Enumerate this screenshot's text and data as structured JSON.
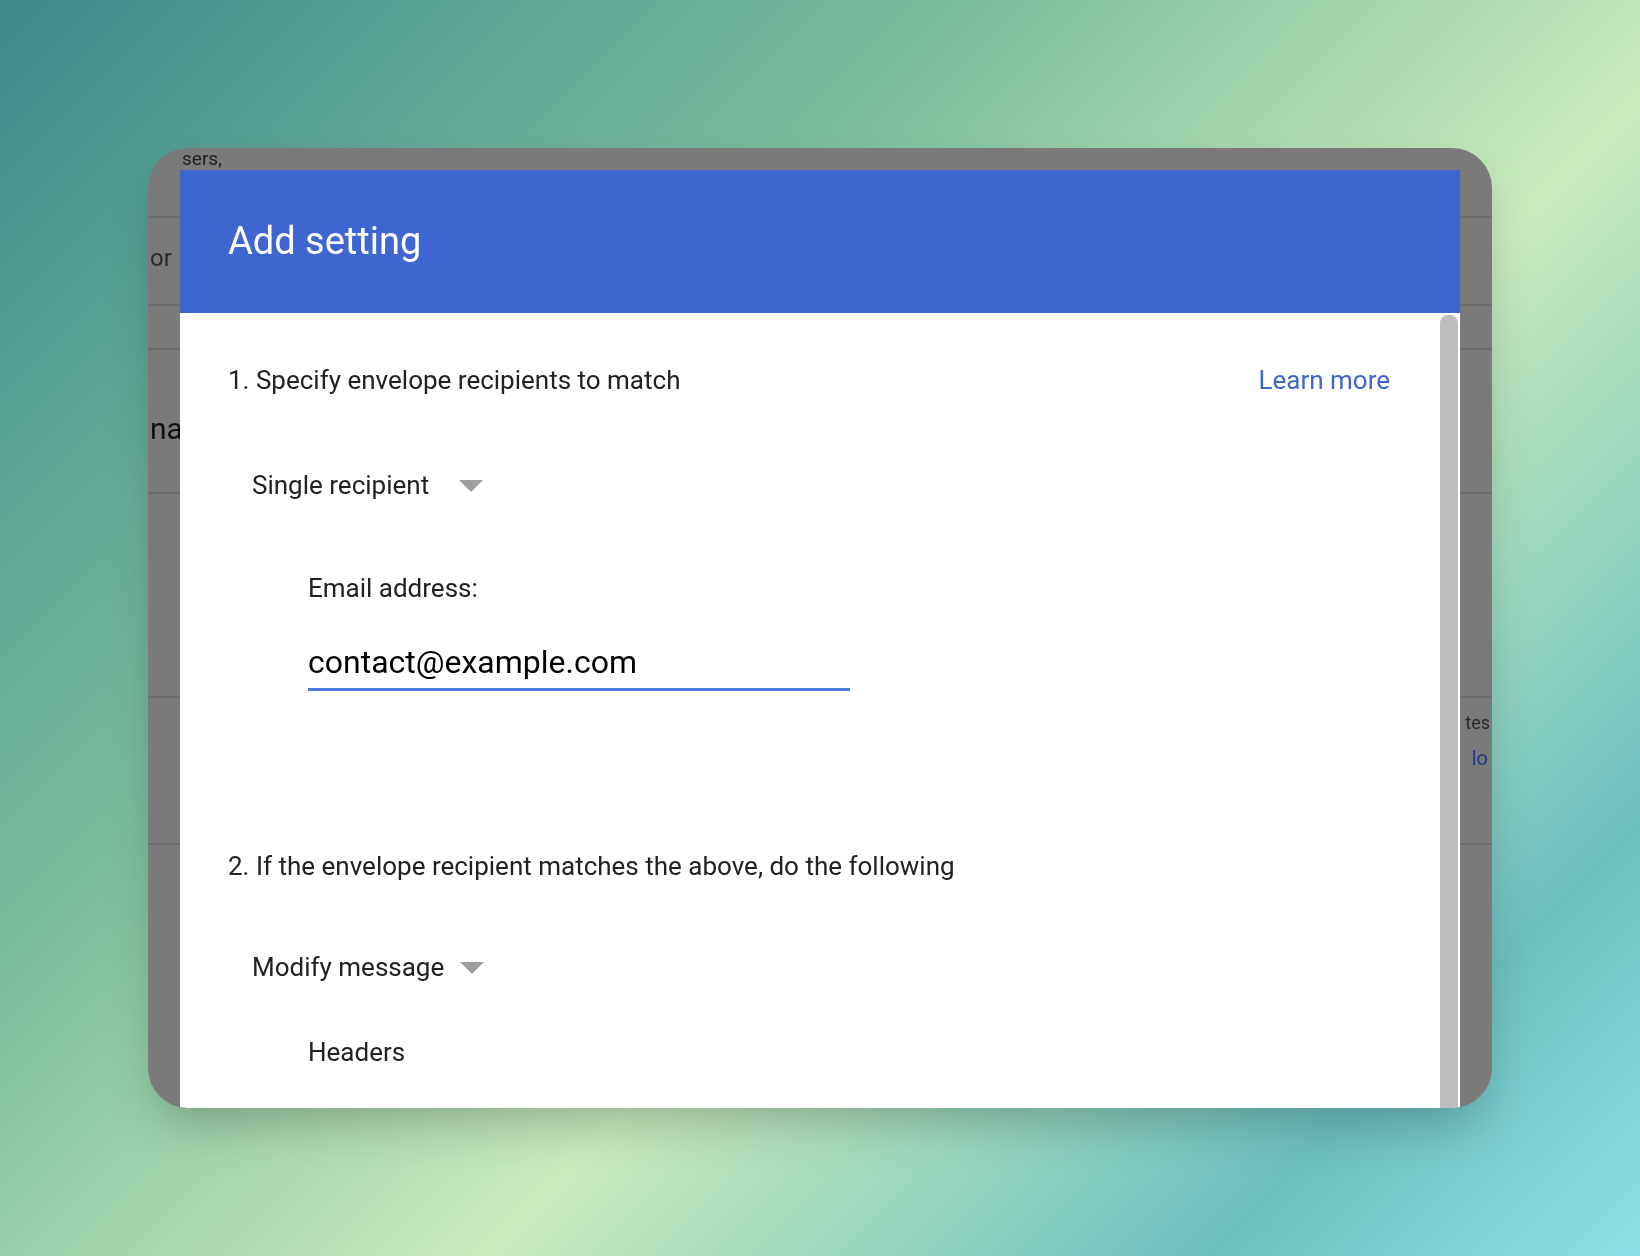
{
  "background_page": {
    "texts": [
      {
        "kind": "heading",
        "text": "sers,"
      },
      {
        "kind": "tab",
        "text": "or"
      },
      {
        "kind": "large",
        "text": "na"
      },
      {
        "kind": "body",
        "text": "tes"
      },
      {
        "kind": "link",
        "text": "lo"
      }
    ]
  },
  "dialog": {
    "title": "Add setting",
    "step_1": {
      "label": "1. Specify envelope recipients to match",
      "link": "Learn more",
      "dropdown": {
        "value": "Single recipient"
      },
      "email": {
        "label": "Email address:",
        "value": "contact@example.com"
      }
    },
    "step_2": {
      "label": "2. If the envelope recipient matches the above, do the following",
      "dropdown": {
        "value": "Modify message"
      },
      "subheading": "Headers"
    }
  }
}
